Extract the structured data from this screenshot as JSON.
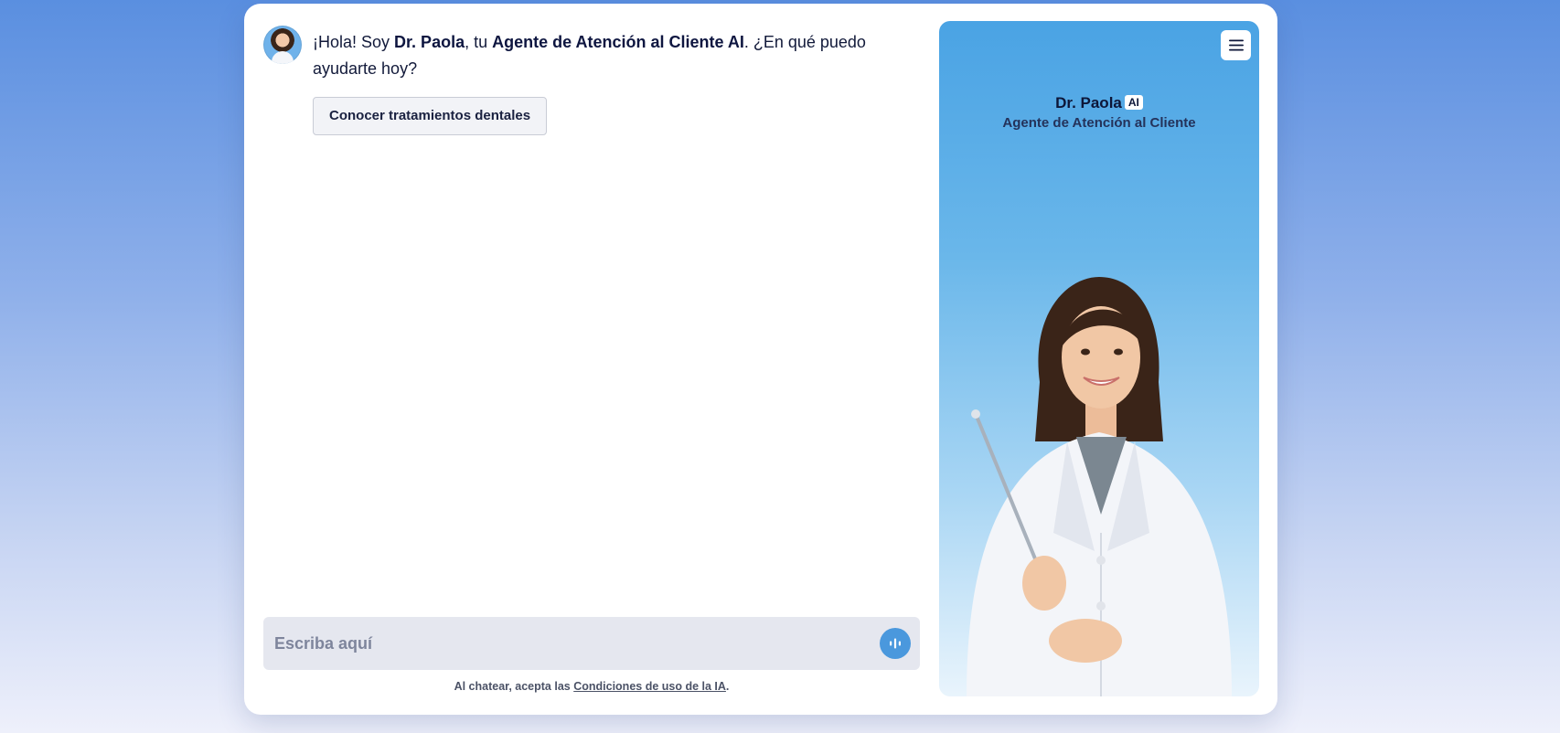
{
  "chat": {
    "greeting": {
      "p1": "¡Hola! Soy ",
      "name": "Dr. Paola",
      "p2": ", tu ",
      "role": "Agente de Atención al Cliente AI",
      "p3": ". ¿En qué puedo ayudarte hoy?"
    },
    "suggestion_chip": "Conocer tratamientos dentales",
    "input_placeholder": "Escriba aquí",
    "terms_prefix": "Al chatear, acepta las ",
    "terms_link": "Condiciones de uso de la IA",
    "terms_suffix": "."
  },
  "agent_panel": {
    "name": "Dr. Paola",
    "badge": "AI",
    "subtitle": "Agente de Atención al Cliente"
  },
  "icons": {
    "voice": "voice-waveform-icon",
    "menu": "hamburger-menu-icon",
    "avatar": "agent-avatar"
  },
  "colors": {
    "accent": "#4a98dd",
    "text_dark": "#121a3a",
    "input_bg": "#e5e7ef"
  }
}
